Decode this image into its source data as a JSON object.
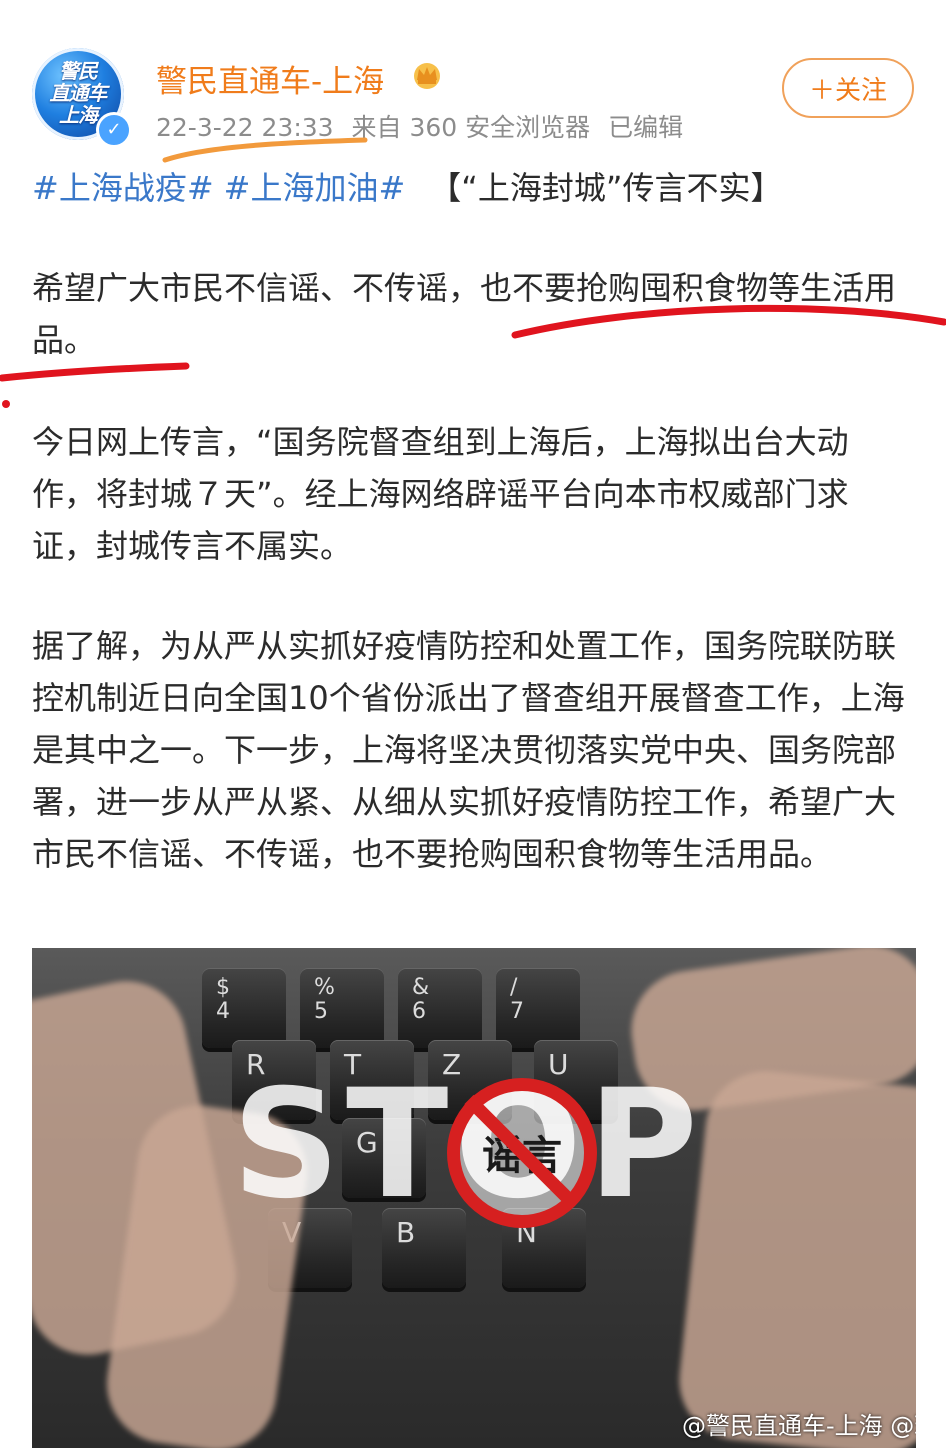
{
  "post": {
    "author": "警民直通车-上海",
    "avatar_text": "警民\n直通车\n上海",
    "date": "22-3-22 23:33",
    "source": "来自 360 安全浏览器",
    "edited": "已编辑",
    "follow_label": "＋关注",
    "tags": [
      "#上海战疫#",
      "#上海加油#"
    ],
    "headline": "【“上海封城”传言不实】",
    "paragraphs": [
      "希望广大市民不信谣、不传谣，也不要抢购囤积食物等生活用品。",
      "今日网上传言，“国务院督查组到上海后，上海拟出台大动作，将封城７天”。经上海网络辟谣平台向本市权威部门求证，封城传言不属实。",
      "据了解，为从严从实抓好疫情防控和处置工作，国务院联防联控机制近日向全国10个省份派出了督查组开展督查工作，上海是其中之一。下一步，上海将坚决贯彻落实党中央、国务院部署，进一步从严从紧、从细从实抓好疫情防控工作，希望广大市民不信谣、不传谣，也不要抢购囤积食物等生活用品。"
    ]
  },
  "image": {
    "stop_text": "STOP",
    "ban_text": "谣言",
    "watermark": "@警民直通车-上海 @理大宝儿姐",
    "keys": [
      "$\n4",
      "%\n5",
      "&\n6",
      "/\n7",
      "R",
      "T",
      "Z",
      "U",
      "G",
      "V",
      "B",
      "N"
    ]
  },
  "colors": {
    "author": "#f07c1b",
    "tag": "#3a78c9",
    "underline_orange": "#f29a3c",
    "underline_red": "#e0141e"
  }
}
